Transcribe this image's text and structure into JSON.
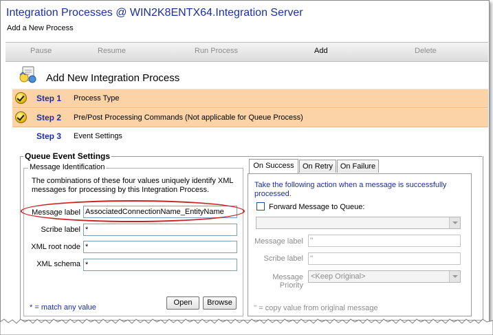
{
  "window": {
    "title": "Integration Processes @ WIN2K8ENTX64.Integration Server",
    "subtitle": "Add a New Process"
  },
  "toolbar": {
    "pause": "Pause",
    "resume": "Resume",
    "run_process": "Run Process",
    "add": "Add",
    "delete": "Delete"
  },
  "header": {
    "title": "Add New Integration Process",
    "icon": "process-wizard-icon"
  },
  "steps": [
    {
      "num": "Step 1",
      "label": "Process Type",
      "status": "done"
    },
    {
      "num": "Step 2",
      "label": "Pre/Post Processing Commands (Not applicable for Queue Process)",
      "status": "done"
    },
    {
      "num": "Step 3",
      "label": "Event Settings",
      "status": "current"
    }
  ],
  "queue_event": {
    "group_label": "Queue Event Settings",
    "message_identification": {
      "group_label": "Message Identification",
      "description": "The combinations of these four values uniquely identify XML messages for processing by this Integration Process.",
      "fields": [
        {
          "label": "Message label",
          "value": "AssociatedConnectionName_EntityName"
        },
        {
          "label": "Scribe label",
          "value": "*"
        },
        {
          "label": "XML root node",
          "value": "*"
        },
        {
          "label": "XML schema",
          "value": "*"
        }
      ],
      "note": "* = match any value",
      "open_label": "Open",
      "browse_label": "Browse"
    },
    "tabs": [
      "On Success",
      "On Retry",
      "On Failure"
    ],
    "selected_tab": "On Success",
    "on_success": {
      "description": "Take the following action when a message is successfully processed.",
      "forward_label": "Forward Message to Queue:",
      "forward_checked": false,
      "queue_value": "",
      "message_label_label": "Message label",
      "message_label_value": "''",
      "scribe_label_label": "Scribe label",
      "scribe_label_value": "''",
      "priority_label": "Message Priority",
      "priority_value": "<Keep Original>",
      "note": "'' = copy value from original message"
    }
  },
  "colors": {
    "title_blue": "#1a2fa0",
    "step_done_bg": "#fbd3a6",
    "highlight_red": "#cc1f1f"
  }
}
